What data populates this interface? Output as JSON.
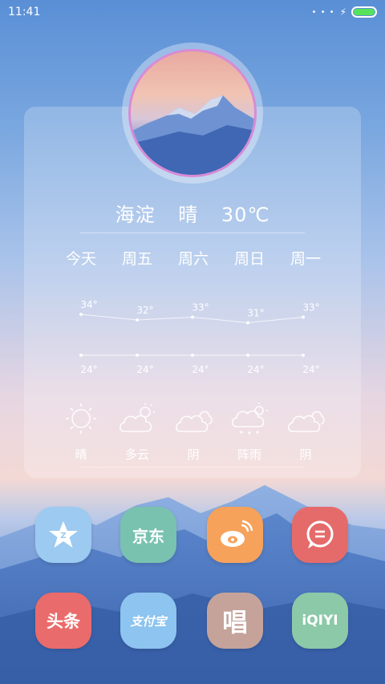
{
  "status_bar": {
    "time": "11:41",
    "dots": "• • •",
    "charge": "⚡",
    "battery_fill": 1.0
  },
  "weather": {
    "location": "海淀",
    "condition": "晴",
    "temperature": "30℃",
    "days": [
      {
        "label": "今天",
        "high": "34°",
        "low": "24°",
        "condition": "晴",
        "icon": "sun-icon"
      },
      {
        "label": "周五",
        "high": "32°",
        "low": "24°",
        "condition": "多云",
        "icon": "partly-cloudy-icon"
      },
      {
        "label": "周六",
        "high": "33°",
        "low": "24°",
        "condition": "阴",
        "icon": "cloudy-icon"
      },
      {
        "label": "周日",
        "high": "31°",
        "low": "24°",
        "condition": "阵雨",
        "icon": "shower-icon"
      },
      {
        "label": "周一",
        "high": "33°",
        "low": "24°",
        "condition": "阴",
        "icon": "cloudy-icon"
      }
    ],
    "high_values": [
      34,
      32,
      33,
      31,
      33
    ],
    "low_values": [
      24,
      24,
      24,
      24,
      24
    ]
  },
  "apps": [
    {
      "name": "qq-browser",
      "label": "",
      "color": "#9ccaf0",
      "icon": "star-icon"
    },
    {
      "name": "jd",
      "label": "京东",
      "color": "#79c2b0"
    },
    {
      "name": "weibo",
      "label": "",
      "color": "#f6a25a",
      "icon": "weibo-icon"
    },
    {
      "name": "messages",
      "label": "",
      "color": "#e56b6b",
      "icon": "chat-icon"
    },
    {
      "name": "toutiao",
      "label": "头条",
      "color": "#ea6b6b"
    },
    {
      "name": "alipay",
      "label": "支付宝",
      "color": "#8dc4f0"
    },
    {
      "name": "changba",
      "label": "唱",
      "color": "#c5a39a"
    },
    {
      "name": "iqiyi",
      "label": "iQIYI",
      "color": "#8cc9a8"
    }
  ]
}
